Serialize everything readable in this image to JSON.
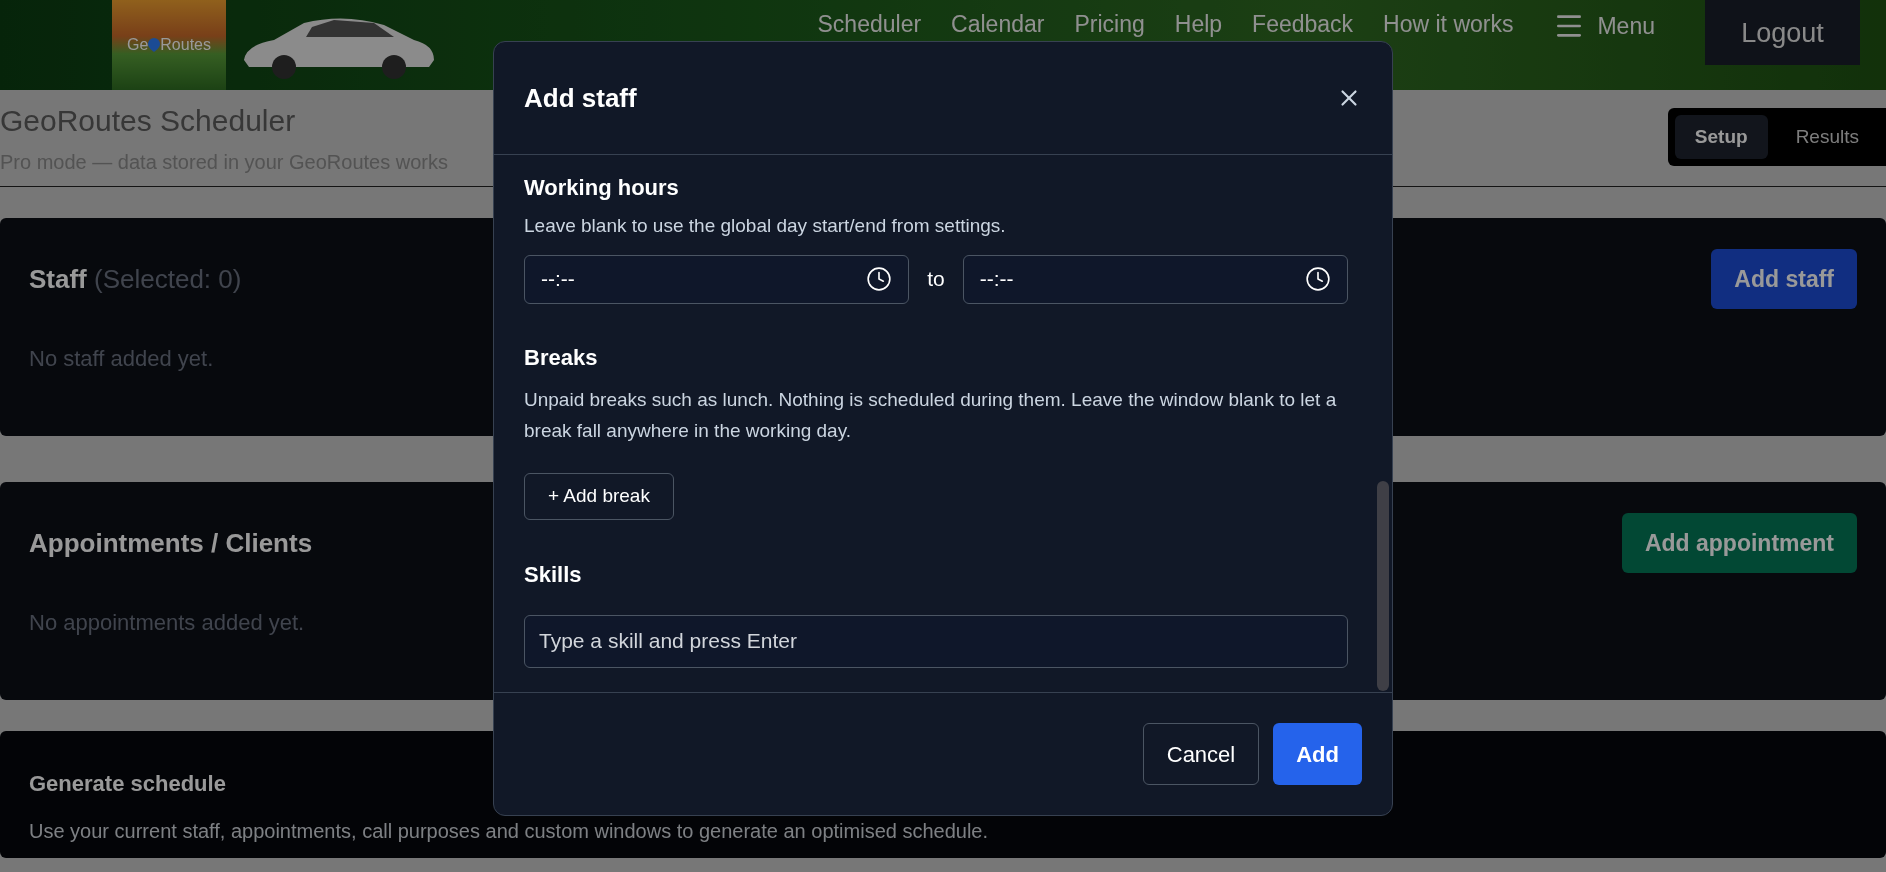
{
  "header": {
    "logo": {
      "text_before": "Ge",
      "text_after": "Routes"
    },
    "nav": [
      "Scheduler",
      "Calendar",
      "Pricing",
      "Help",
      "Feedback",
      "How it works"
    ],
    "menu": "Menu",
    "logout": "Logout"
  },
  "page": {
    "title": "GeoRoutes Scheduler",
    "subtitle": "Pro mode — data stored in your GeoRoutes works",
    "view_tabs": [
      {
        "label": "Setup",
        "selected": true
      },
      {
        "label": "Results",
        "selected": false
      }
    ]
  },
  "cards": [
    {
      "title": "Staff",
      "count": "(Selected: 0)",
      "empty": "No staff added yet.",
      "button": "Add staff",
      "kind": "primary"
    },
    {
      "title": "Appointments / Clients",
      "empty": "No appointments added yet.",
      "button": "Add appointment",
      "kind": "success"
    }
  ],
  "generate": {
    "title": "Generate schedule",
    "text": "Use your current staff, appointments, call purposes and custom windows to generate an optimised schedule."
  },
  "dialog": {
    "title": "Add staff",
    "working_hours": {
      "heading": "Working hours",
      "help": "Leave blank to use the global day start/end from settings.",
      "start": "--:--",
      "separator": "to",
      "end": "--:--"
    },
    "breaks": {
      "heading": "Breaks",
      "help": "Unpaid breaks such as lunch. Nothing is scheduled during them. Leave the window blank to let a break fall anywhere in the working day.",
      "add_button": "+ Add break"
    },
    "skills": {
      "heading": "Skills",
      "placeholder": "Type a skill and press Enter"
    },
    "buttons": {
      "cancel": "Cancel",
      "confirm": "Add"
    }
  }
}
